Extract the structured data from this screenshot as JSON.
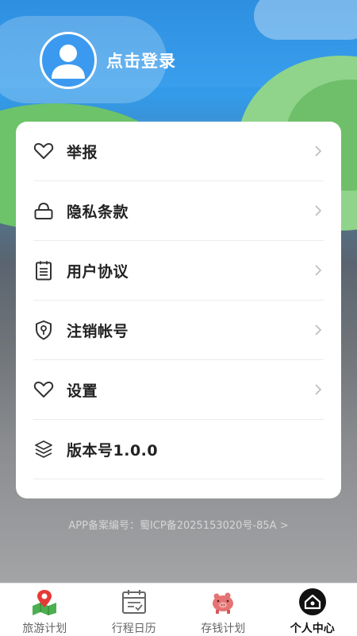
{
  "header": {
    "login_label": "点击登录",
    "avatar_icon": "user-avatar-icon"
  },
  "menu": {
    "items": [
      {
        "label": "举报",
        "icon": "heart-icon",
        "chevron": true
      },
      {
        "label": "隐私条款",
        "icon": "lock-icon",
        "chevron": true
      },
      {
        "label": "用户协议",
        "icon": "clipboard-icon",
        "chevron": true
      },
      {
        "label": "注销帐号",
        "icon": "shield-icon",
        "chevron": true
      },
      {
        "label": "设置",
        "icon": "heart-icon",
        "chevron": true
      },
      {
        "label": "版本号1.0.0",
        "icon": "layers-icon",
        "chevron": false
      }
    ]
  },
  "footer": {
    "icp_text": "APP备案编号：蜀ICP备2025153020号-85A >"
  },
  "tabbar": {
    "tabs": [
      {
        "label": "旅游计划",
        "icon": "map-pin-icon",
        "active": false
      },
      {
        "label": "行程日历",
        "icon": "calendar-icon",
        "active": false
      },
      {
        "label": "存钱计划",
        "icon": "piggy-bank-icon",
        "active": false
      },
      {
        "label": "个人中心",
        "icon": "home-icon",
        "active": true
      }
    ]
  },
  "colors": {
    "card_bg": "#ffffff",
    "text_primary": "#222222",
    "accent_active": "#111111"
  }
}
